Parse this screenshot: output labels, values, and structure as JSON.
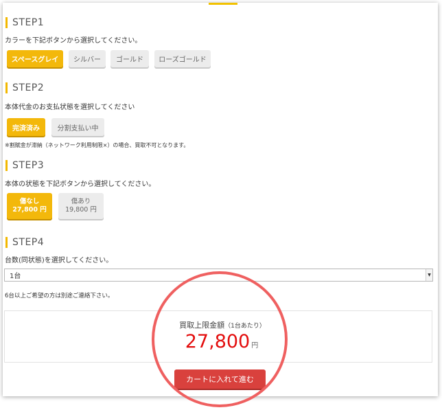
{
  "step1": {
    "title": "STEP1",
    "instruction": "カラーを下記ボタンから選択してください。",
    "options": [
      "スペースグレイ",
      "シルバー",
      "ゴールド",
      "ローズゴールド"
    ]
  },
  "step2": {
    "title": "STEP2",
    "instruction": "本体代金のお支払状態を選択してください",
    "options": [
      "完済済み",
      "分割支払い中"
    ],
    "note": "※割賦金が滞納（ネットワーク利用制限×）の場合、買取不可となります。"
  },
  "step3": {
    "title": "STEP3",
    "instruction": "本体の状態を下記ボタンから選択してください。",
    "options": [
      {
        "label": "傷なし",
        "price": "27,800 円"
      },
      {
        "label": "傷あり",
        "price": "19,800 円"
      }
    ]
  },
  "step4": {
    "title": "STEP4",
    "instruction": "台数(同状態)を選択してください。",
    "selected_quantity": "1台",
    "note": "6台以上ご希望の方は別途ご連絡下さい。"
  },
  "price": {
    "label": "買取上限金額",
    "label_suffix": "（1台あたり）",
    "amount": "27,800",
    "unit": "円"
  },
  "cart_button": "カートに入れて進む",
  "colors": {
    "accent": "#f3b80b",
    "price_red": "#e30d0d",
    "button_red": "#d9413d",
    "circle": "#ef6060"
  }
}
